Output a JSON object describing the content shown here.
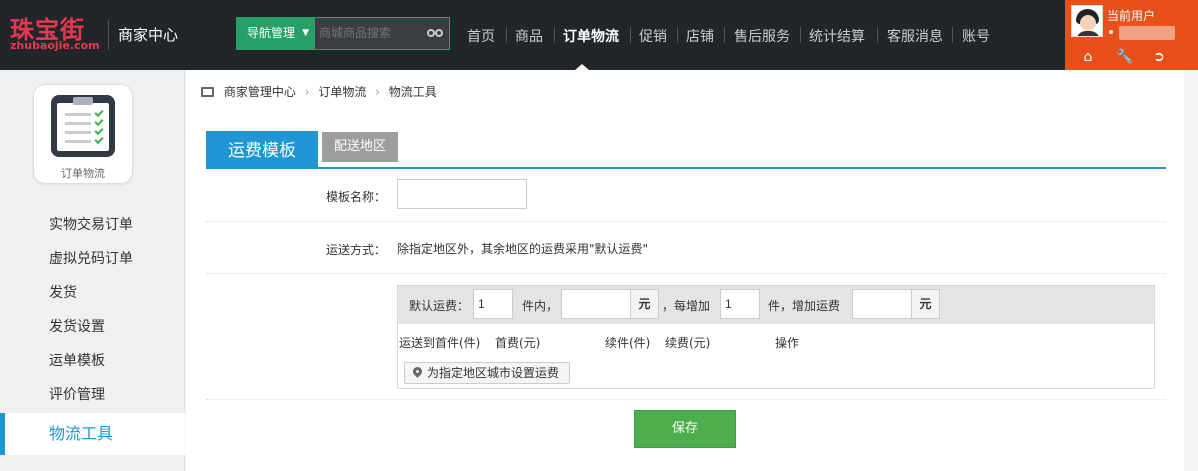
{
  "header": {
    "logo_cn": "珠宝街",
    "logo_en": "zhubaojie.com",
    "center_title": "商家中心",
    "nav_button": "导航管理",
    "search_placeholder": "商城商品搜索",
    "nav_items": [
      "首页",
      "商品",
      "订单物流",
      "促销",
      "店铺",
      "售后服务",
      "统计结算",
      "客服消息",
      "账号"
    ],
    "active_nav": "订单物流",
    "user_label": "当前用户",
    "tools": [
      "home-icon",
      "wrench-icon",
      "logout-icon"
    ],
    "accent_color": "#27a067",
    "user_color": "#e8501a"
  },
  "sidebar": {
    "icon_label": "订单物流",
    "items": [
      "实物交易订单",
      "虚拟兑码订单",
      "发货",
      "发货设置",
      "运单模板",
      "评价管理",
      "物流工具"
    ],
    "active_item": "物流工具",
    "active_color": "#1d96d3"
  },
  "breadcrumb": [
    "商家管理中心",
    "订单物流",
    "物流工具"
  ],
  "tabs": {
    "active": "运费模板",
    "inactive": "配送地区"
  },
  "form": {
    "name_label": "模板名称：",
    "name_value": "",
    "ship_label": "运送方式：",
    "ship_text": "除指定地区外，其余地区的运费采用\"默认运费\"",
    "fee": {
      "default_label": "默认运费：",
      "first_count": "1",
      "within_label": "件内，",
      "first_fee": "",
      "unit_yuan": "元",
      "each_add_label": "，每增加",
      "add_count": "1",
      "add_fee_label": "件，增加运费",
      "add_fee": ""
    },
    "columns": [
      "运送到",
      "首件(件)",
      "首费(元)",
      "续件(件)",
      "续费(元)",
      "操作"
    ],
    "region_button": "为指定地区城市设置运费",
    "save": "保存"
  }
}
